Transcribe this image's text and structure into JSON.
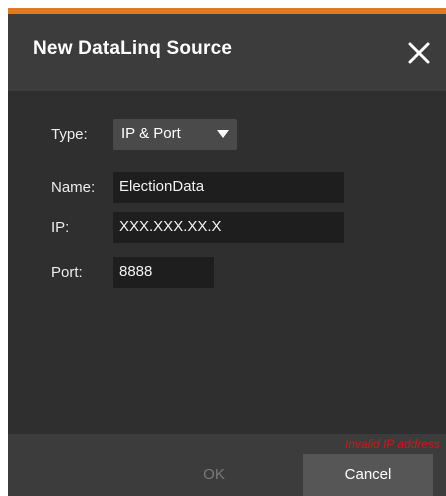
{
  "dialog": {
    "title": "New DataLinq Source",
    "close_icon": "close-icon",
    "accent_color": "#e07a1f"
  },
  "form": {
    "type_label": "Type:",
    "type_value": "IP & Port",
    "name_label": "Name:",
    "name_value": "ElectionData",
    "ip_label": "IP:",
    "ip_value": "XXX.XXX.XX.X",
    "port_label": "Port:",
    "port_value": "8888"
  },
  "footer": {
    "error_text": "Invalid IP address",
    "error_color": "#cc1a1a",
    "ok_label": "OK",
    "cancel_label": "Cancel"
  }
}
